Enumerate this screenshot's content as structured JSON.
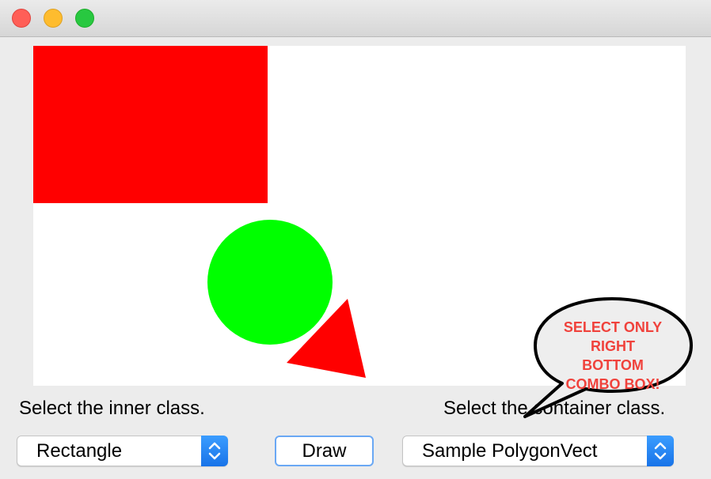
{
  "window": {
    "buttons": [
      "close",
      "minimize",
      "zoom"
    ]
  },
  "canvas": {
    "shapes": [
      {
        "type": "rectangle",
        "color": "#ff0000"
      },
      {
        "type": "circle",
        "color": "#00ff00"
      },
      {
        "type": "triangle",
        "color": "#ff0000"
      }
    ]
  },
  "labels": {
    "inner": "Select the inner class.",
    "container": "Select the container class."
  },
  "controls": {
    "inner_combo_value": "Rectangle",
    "draw_label": "Draw",
    "container_combo_value": "Sample PolygonVect"
  },
  "callout": {
    "lines": [
      "SELECT ONLY",
      "RIGHT",
      "BOTTOM",
      "COMBO BOX!"
    ],
    "color": "#f0423c"
  }
}
